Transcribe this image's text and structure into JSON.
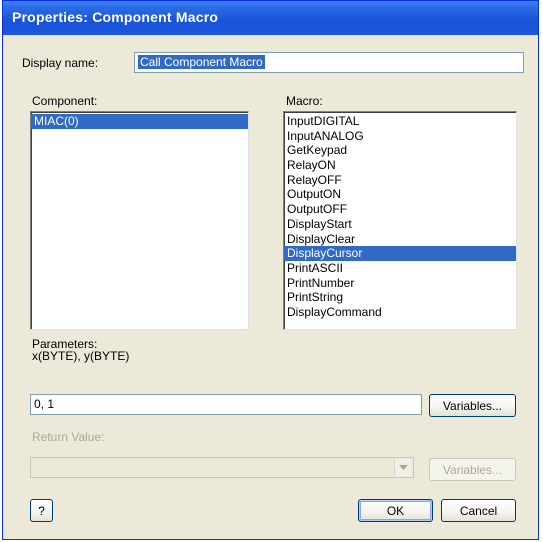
{
  "window": {
    "title": "Properties: Component Macro"
  },
  "display_name": {
    "label": "Display name:",
    "value": "Call Component Macro"
  },
  "component": {
    "label": "Component:",
    "items": [
      "MIAC(0)"
    ],
    "selected_index": 0
  },
  "macro": {
    "label": "Macro:",
    "items": [
      "InputDIGITAL",
      "InputANALOG",
      "GetKeypad",
      "RelayON",
      "RelayOFF",
      "OutputON",
      "OutputOFF",
      "DisplayStart",
      "DisplayClear",
      "DisplayCursor",
      "PrintASCII",
      "PrintNumber",
      "PrintString",
      "DisplayCommand"
    ],
    "selected_index": 9
  },
  "parameters": {
    "label": "Parameters:",
    "signature": "x(BYTE), y(BYTE)",
    "value": "0, 1"
  },
  "return_value": {
    "label": "Return Value:",
    "value": ""
  },
  "buttons": {
    "variables": "Variables...",
    "variables_disabled": "Variables...",
    "help": "?",
    "ok": "OK",
    "cancel": "Cancel"
  },
  "colors": {
    "title_bar": "#1853d9",
    "selection": "#316ac5",
    "dialog_bg": "#ece9d8"
  }
}
